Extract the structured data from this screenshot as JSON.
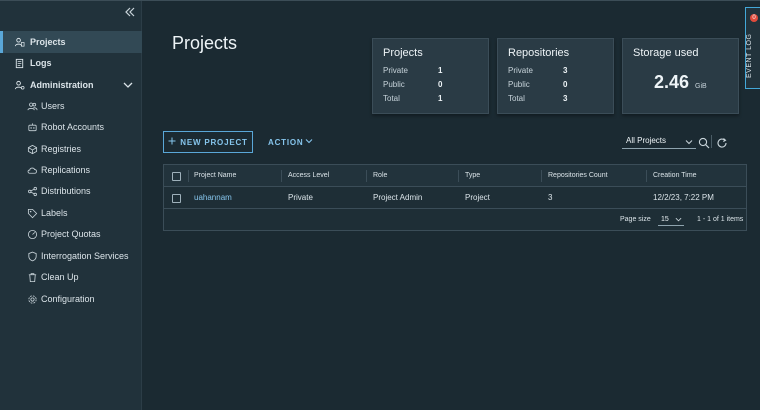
{
  "sidebar": {
    "items": [
      {
        "label": "Projects",
        "icon": "projects-icon"
      },
      {
        "label": "Logs",
        "icon": "logs-icon"
      },
      {
        "label": "Administration",
        "icon": "users-admin-icon"
      },
      {
        "label": "Users",
        "icon": "users-icon"
      },
      {
        "label": "Robot Accounts",
        "icon": "robot-icon"
      },
      {
        "label": "Registries",
        "icon": "registry-icon"
      },
      {
        "label": "Replications",
        "icon": "cloud-sync-icon"
      },
      {
        "label": "Distributions",
        "icon": "share-icon"
      },
      {
        "label": "Labels",
        "icon": "tag-icon"
      },
      {
        "label": "Project Quotas",
        "icon": "gauge-icon"
      },
      {
        "label": "Interrogation Services",
        "icon": "shield-icon"
      },
      {
        "label": "Clean Up",
        "icon": "trash-icon"
      },
      {
        "label": "Configuration",
        "icon": "gear-icon"
      }
    ]
  },
  "page": {
    "title": "Projects"
  },
  "summary": {
    "projects": {
      "title": "Projects",
      "rows": [
        {
          "label": "Private",
          "value": "1"
        },
        {
          "label": "Public",
          "value": "0"
        },
        {
          "label": "Total",
          "value": "1"
        }
      ]
    },
    "repositories": {
      "title": "Repositories",
      "rows": [
        {
          "label": "Private",
          "value": "3"
        },
        {
          "label": "Public",
          "value": "0"
        },
        {
          "label": "Total",
          "value": "3"
        }
      ]
    },
    "storage": {
      "title": "Storage used",
      "value": "2.46",
      "unit": "GiB"
    }
  },
  "event_log": {
    "label": "EVENT LOG",
    "badge": "0"
  },
  "toolbar": {
    "new_project_label": "NEW PROJECT",
    "action_label": "ACTION",
    "filter_value": "All Projects"
  },
  "table": {
    "columns": [
      "Project Name",
      "Access Level",
      "Role",
      "Type",
      "Repositories Count",
      "Creation Time"
    ],
    "rows": [
      {
        "name": "uahannam",
        "access": "Private",
        "role": "Project Admin",
        "type": "Project",
        "repos": "3",
        "created": "12/2/23, 7:22 PM"
      }
    ],
    "footer": {
      "page_size_label": "Page size",
      "page_size": "15",
      "range": "1 - 1 of 1 items"
    }
  },
  "colors": {
    "accent": "#5aa7d8",
    "link": "#86c5ec",
    "badge": "#e04b3c",
    "background": "#1b2a32",
    "sidebar": "#21323b"
  }
}
